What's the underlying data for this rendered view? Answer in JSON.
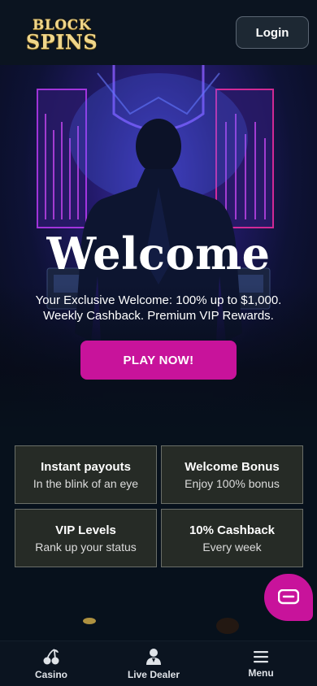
{
  "header": {
    "logo_line1": "BLOCK",
    "logo_line2": "SPINS",
    "login_label": "Login"
  },
  "hero": {
    "title": "Welcome",
    "subtitle_line1": "Your Exclusive Welcome: 100% up to $1,000.",
    "subtitle_line2": "Weekly Cashback. Premium VIP Rewards.",
    "cta_label": "PLAY NOW!"
  },
  "features": [
    {
      "title": "Instant payouts",
      "desc": "In the blink of an eye"
    },
    {
      "title": "Welcome Bonus",
      "desc": "Enjoy 100% bonus"
    },
    {
      "title": "VIP Levels",
      "desc": "Rank up your status"
    },
    {
      "title": "10% Cashback",
      "desc": "Every week"
    }
  ],
  "bottom_nav": [
    {
      "label": "Casino",
      "icon": "cherries-icon"
    },
    {
      "label": "Live Dealer",
      "icon": "dealer-icon"
    },
    {
      "label": "Menu",
      "icon": "hamburger-menu-icon"
    }
  ],
  "colors": {
    "accent": "#c8139b",
    "background": "#07111c",
    "header": "#0b1420",
    "logo_gold": "#f0d68a"
  }
}
